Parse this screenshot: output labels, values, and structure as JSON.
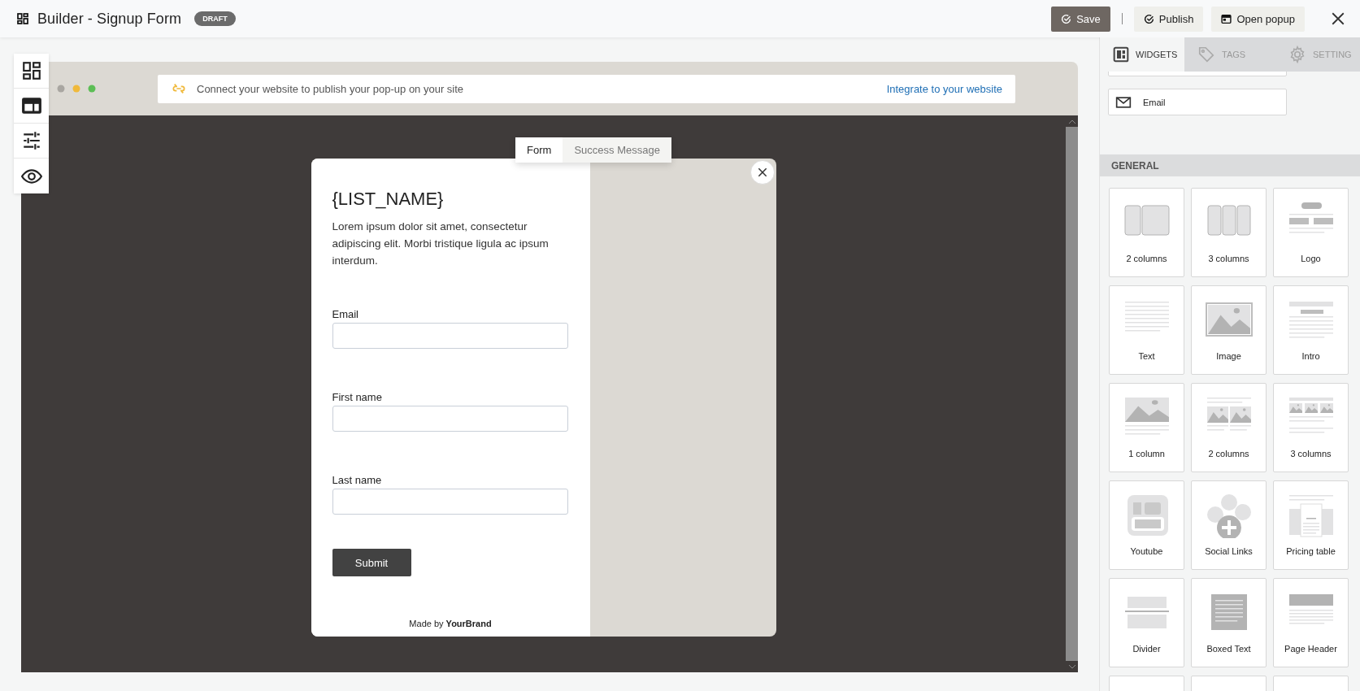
{
  "header": {
    "title": "Builder - Signup Form",
    "badge": "DRAFT",
    "actions": [
      {
        "label": "Save",
        "kind": "primary"
      },
      {
        "label": "Publish",
        "kind": "check"
      },
      {
        "label": "Open popup",
        "kind": "window"
      }
    ]
  },
  "toolbar": [
    {
      "kind": "dashboard",
      "selected": false
    },
    {
      "kind": "layout",
      "selected": false
    },
    {
      "kind": "sliders",
      "selected": false
    },
    {
      "kind": "preview",
      "selected": false
    }
  ],
  "notice": {
    "text": "Connect your website to publish your pop-up on your site",
    "link": "Integrate to your website"
  },
  "popup_tabs": [
    {
      "label": "Form",
      "selected": true
    },
    {
      "label": "Success Message",
      "selected": false
    }
  ],
  "popup": {
    "title": "{LIST_NAME}",
    "description": "Lorem ipsum dolor sit amet, consectetur adipiscing elit. Morbi tristique ligula ac ipsum interdum.",
    "fields": [
      {
        "label": "Email"
      },
      {
        "label": "First name"
      },
      {
        "label": "Last name"
      }
    ],
    "submit": "Submit",
    "footer": "Made by **YourBrand**"
  },
  "panel_tabs": [
    {
      "label": "WIDGETS",
      "kind": "widgets",
      "selected": true
    },
    {
      "label": "TAGS",
      "kind": "tag",
      "selected": false
    },
    {
      "label": "SETTING",
      "kind": "gear",
      "selected": false
    }
  ],
  "field_items": [
    {
      "label": "Email"
    }
  ],
  "section": "GENERAL",
  "widgets": [
    {
      "label": "2 columns",
      "kind": "columns2"
    },
    {
      "label": "3 columns",
      "kind": "columns3"
    },
    {
      "label": "Logo",
      "kind": "logo"
    },
    {
      "label": "Text",
      "kind": "text"
    },
    {
      "label": "Image",
      "kind": "image"
    },
    {
      "label": "Intro",
      "kind": "intro"
    },
    {
      "label": "1 column",
      "kind": "image1"
    },
    {
      "label": "2 columns",
      "kind": "image2"
    },
    {
      "label": "3 columns",
      "kind": "image3"
    },
    {
      "label": "Youtube",
      "kind": "youtube"
    },
    {
      "label": "Social Links",
      "kind": "social"
    },
    {
      "label": "Pricing table",
      "kind": "pricing"
    },
    {
      "label": "Divider",
      "kind": "divider"
    },
    {
      "label": "Boxed Text",
      "kind": "boxed"
    },
    {
      "label": "Page Header",
      "kind": "header"
    }
  ]
}
